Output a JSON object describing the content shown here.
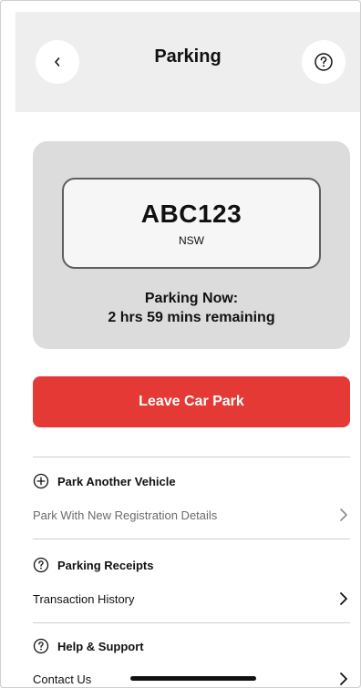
{
  "header": {
    "title": "Parking",
    "back_icon": "chevron-left-icon",
    "help_icon": "question-circle-icon"
  },
  "vehicle": {
    "plate": "ABC123",
    "state": "NSW",
    "status_line1": "Parking Now:",
    "status_line2": "2 hrs 59 mins remaining"
  },
  "actions": {
    "leave_label": "Leave Car Park"
  },
  "sections": [
    {
      "icon": "plus-circle-icon",
      "title": "Park Another Vehicle",
      "row_label": "Park With New Registration Details",
      "row_muted": true
    },
    {
      "icon": "question-circle-icon",
      "title": "Parking Receipts",
      "row_label": "Transaction History",
      "row_muted": false
    },
    {
      "icon": "question-circle-icon",
      "title": "Help & Support",
      "row_label": "Contact Us",
      "row_muted": false
    }
  ],
  "colors": {
    "accent": "#e53935",
    "header_bg": "#eeeeee",
    "card_bg": "#dcdcdc"
  }
}
